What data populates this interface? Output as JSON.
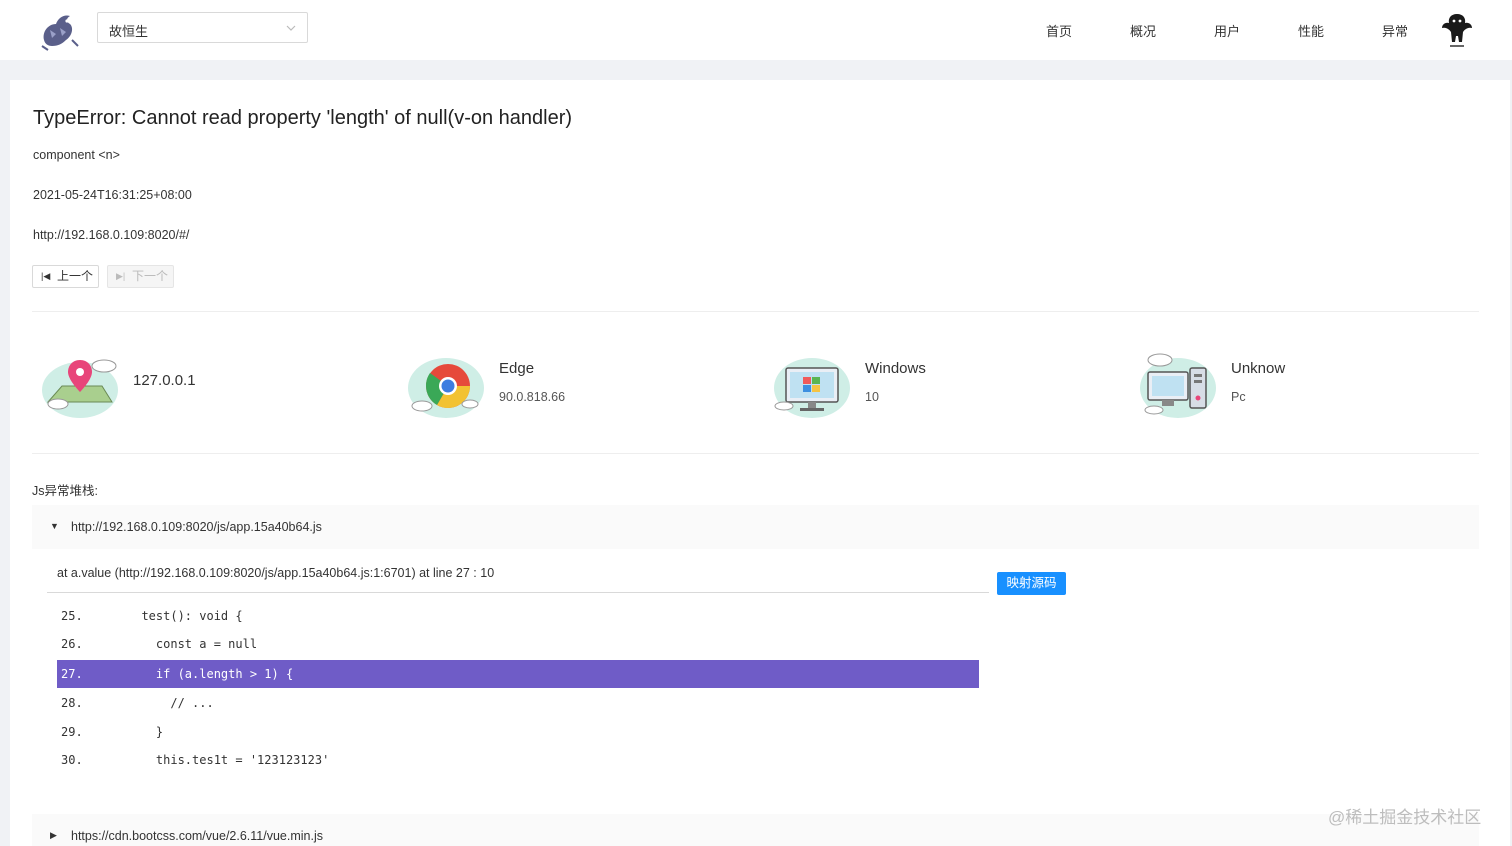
{
  "header": {
    "project_select": "故恒生",
    "nav": [
      "首页",
      "概况",
      "用户",
      "性能",
      "异常"
    ]
  },
  "error": {
    "title": "TypeError: Cannot read property 'length' of null(v-on handler)",
    "component": "component <n>",
    "time": "2021-05-24T16:31:25+08:00",
    "url": "http://192.168.0.109:8020/#/",
    "prev_label": "上一个",
    "next_label": "下一个"
  },
  "stats": [
    {
      "icon": "location-pin-icon",
      "main": "127.0.0.1",
      "sub": ""
    },
    {
      "icon": "chrome-browser-icon",
      "main": "Edge",
      "sub": "90.0.818.66"
    },
    {
      "icon": "desktop-monitor-icon",
      "main": "Windows",
      "sub": "10"
    },
    {
      "icon": "computer-tower-icon",
      "main": "Unknow",
      "sub": "Pc"
    }
  ],
  "stack": {
    "label": "Js异常堆栈:",
    "files": [
      {
        "url": "http://192.168.0.109:8020/js/app.15a40b64.js",
        "expanded": true
      },
      {
        "url": "https://cdn.bootcss.com/vue/2.6.11/vue.min.js",
        "expanded": false
      }
    ],
    "frame": "at a.value (http://192.168.0.109:8020/js/app.15a40b64.js:1:6701) at line 27 : 10",
    "map_button": "映射源码",
    "code": [
      {
        "ln": "25.",
        "text": "  test(): void {",
        "highlight": false
      },
      {
        "ln": "26.",
        "text": "    const a = null",
        "highlight": false
      },
      {
        "ln": "27.",
        "text": "    if (a.length > 1) {",
        "highlight": true
      },
      {
        "ln": "28.",
        "text": "      // ...",
        "highlight": false
      },
      {
        "ln": "29.",
        "text": "    }",
        "highlight": false
      },
      {
        "ln": "30.",
        "text": "    this.tes1t = '123123123'",
        "highlight": false
      }
    ]
  },
  "watermark": "@稀土掘金技术社区",
  "colors": {
    "accent": "#1890ff",
    "highlight": "#6f5cc7"
  }
}
